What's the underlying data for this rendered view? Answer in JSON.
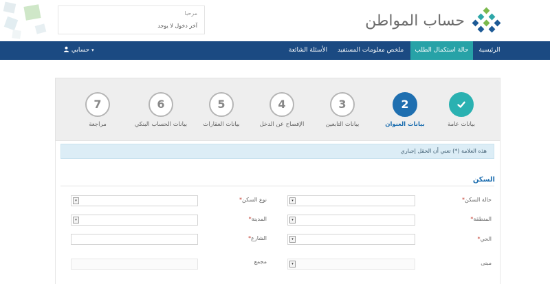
{
  "header": {
    "logo_text": "حساب المواطن",
    "welcome_line1": "مرحبا",
    "welcome_line2": "آخر دخول لا يوجد"
  },
  "nav": {
    "items": [
      {
        "label": "الرئيسية",
        "active": false
      },
      {
        "label": "حالة استكمال الطلب",
        "active": true
      },
      {
        "label": "ملخص معلومات المستفيد",
        "active": false
      },
      {
        "label": "الأسئلة الشائعة",
        "active": false
      }
    ],
    "account_label": "حسابي"
  },
  "steps": [
    {
      "number": "✓",
      "label": "بيانات عامة",
      "state": "done"
    },
    {
      "number": "2",
      "label": "بيانات العنوان",
      "state": "current"
    },
    {
      "number": "3",
      "label": "بيانات التابعين",
      "state": "pending"
    },
    {
      "number": "4",
      "label": "الإفصاح عن الدخل",
      "state": "pending"
    },
    {
      "number": "5",
      "label": "بيانات العقارات",
      "state": "pending"
    },
    {
      "number": "6",
      "label": "بيانات الحساب البنكي",
      "state": "pending"
    },
    {
      "number": "7",
      "label": "مراجعة",
      "state": "pending"
    }
  ],
  "form": {
    "info_text": "هذه العلامة (*) تعني أن الحقل إجباري",
    "section_title": "السكن",
    "fields": {
      "housing_status": {
        "label": "حالة السكن",
        "required": true
      },
      "housing_type": {
        "label": "نوع السكن",
        "required": true
      },
      "region": {
        "label": "المنطقة",
        "required": true
      },
      "city": {
        "label": "المدينة",
        "required": true
      },
      "district": {
        "label": "الحي",
        "required": true
      },
      "street": {
        "label": "الشارع",
        "required": true
      },
      "building": {
        "label": "مبنى",
        "required": false
      },
      "compound": {
        "label": "مجمع",
        "required": false
      }
    }
  },
  "colors": {
    "nav_bg": "#1b4a82",
    "nav_active": "#27a2a7",
    "step_done": "#2ab1b1",
    "step_current": "#1f6fb0",
    "accent_text": "#1f6fb0"
  }
}
